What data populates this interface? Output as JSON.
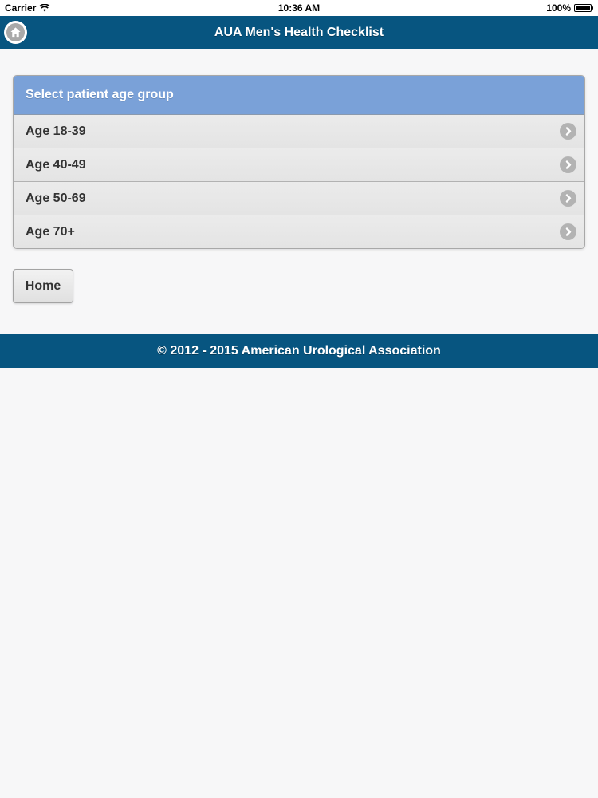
{
  "status_bar": {
    "carrier": "Carrier",
    "time": "10:36 AM",
    "battery": "100%",
    "battery_level": 1.0
  },
  "header": {
    "title": "AUA Men's Health Checklist",
    "home_icon": "home-icon"
  },
  "age_list": {
    "header": "Select patient age group",
    "items": [
      {
        "label": "Age 18-39"
      },
      {
        "label": "Age 40-49"
      },
      {
        "label": "Age 50-69"
      },
      {
        "label": "Age 70+"
      }
    ]
  },
  "home_button": {
    "label": "Home"
  },
  "footer": {
    "text": "© 2012 - 2015 American Urological Association"
  },
  "colors": {
    "bar": "#075580",
    "list_header": "#7aa1d8",
    "background": "#f7f7f8",
    "item_bg": "#e8e8e8"
  }
}
